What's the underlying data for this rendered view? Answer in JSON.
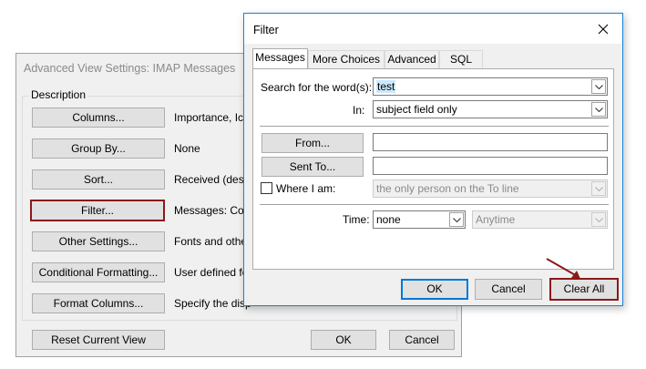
{
  "adv": {
    "title": "Advanced View Settings: IMAP Messages",
    "group_label": "Description",
    "rows": [
      {
        "button": "Columns...",
        "desc": "Importance, Ico"
      },
      {
        "button": "Group By...",
        "desc": "None"
      },
      {
        "button": "Sort...",
        "desc": "Received (desce"
      },
      {
        "button": "Filter...",
        "desc": "Messages: Con"
      },
      {
        "button": "Other Settings...",
        "desc": "Fonts and othe"
      },
      {
        "button": "Conditional Formatting...",
        "desc": "User defined fo"
      },
      {
        "button": "Format Columns...",
        "desc": "Specify the disp"
      }
    ],
    "reset_label": "Reset Current View",
    "ok_label": "OK",
    "cancel_label": "Cancel"
  },
  "filter": {
    "title": "Filter",
    "tabs": [
      "Messages",
      "More Choices",
      "Advanced",
      "SQL"
    ],
    "search_label": "Search for the word(s):",
    "search_value": "test",
    "in_label": "In:",
    "in_value": "subject field only",
    "from_label": "From...",
    "sentto_label": "Sent To...",
    "whereiam_label": "Where I am:",
    "whereiam_value": "the only person on the To line",
    "time_label": "Time:",
    "time_value": "none",
    "time_range_value": "Anytime",
    "ok_label": "OK",
    "cancel_label": "Cancel",
    "clearall_label": "Clear All"
  },
  "colors": {
    "highlight_border": "#8b1a1a",
    "default_button_border": "#0078d7",
    "selection": "#cce8ff",
    "window_border": "#1883d7"
  },
  "icons": {
    "close": "close-icon",
    "dropdown": "chevron-down-icon",
    "annotation": "arrow-annotation-icon"
  }
}
